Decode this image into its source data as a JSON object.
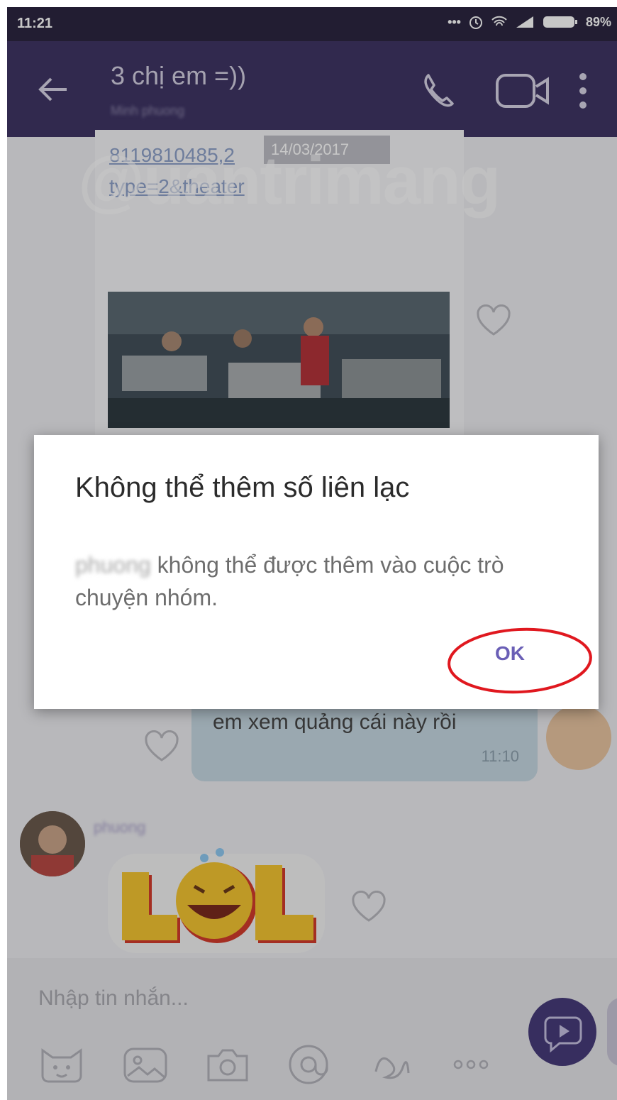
{
  "status_bar": {
    "time": "11:21",
    "battery": "89%"
  },
  "header": {
    "title": "3 chị em =))",
    "subtitle": "Minh phuong"
  },
  "chat": {
    "link_message": {
      "link_line1": "8119810485,2",
      "link_line2": "type=2&theater",
      "date": "14/03/2017"
    },
    "own_message": {
      "text": "em xem quảng cái này rồi",
      "time": "11:10"
    },
    "incoming": {
      "sender": "phuong",
      "sticker_text": "LOL"
    }
  },
  "input": {
    "placeholder": "Nhập tin nhắn..."
  },
  "dialog": {
    "title": "Không thể thêm số liên lạc",
    "body_name": "phuong",
    "body_text": " không thể được thêm vào cuộc trò chuyện nhóm.",
    "ok_label": "OK"
  },
  "watermark": "@uantrimang",
  "colors": {
    "header_bg": "#3f3565",
    "accent": "#6a5fb6",
    "highlight_circle": "#e0181f",
    "send_button": "#473b7a"
  }
}
